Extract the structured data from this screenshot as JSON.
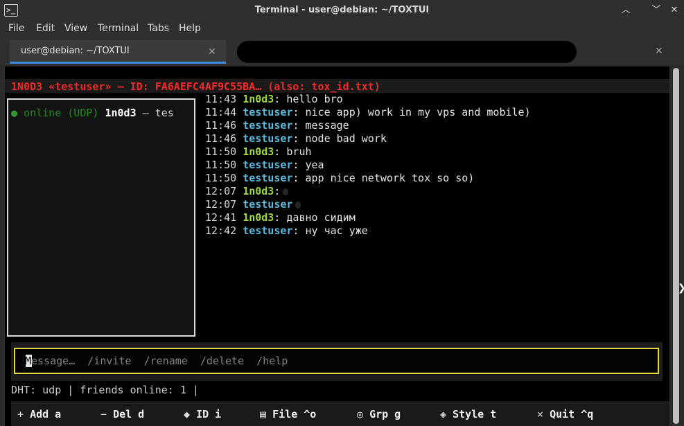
{
  "window": {
    "title": "Terminal - user@debian: ~/TOXTUI",
    "app_icon": ">_",
    "buttons": {
      "up": "︿",
      "down": "﹀",
      "close": "✕"
    }
  },
  "menu": [
    "File",
    "Edit",
    "View",
    "Terminal",
    "Tabs",
    "Help"
  ],
  "tabs": {
    "active_label": "user@debian: ~/TOXTUI",
    "close": "✕"
  },
  "terminal": {
    "header": "1N0D3 «testuser» — ID: FA6AEFC4AF9C55BA… (also: tox_id.txt)",
    "contact": {
      "dot": "●",
      "status": "online (UDP)",
      "name": "1n0d3",
      "rest": " — tes"
    },
    "messages": [
      {
        "time": "11:43",
        "nick": "1n0d3",
        "text": ": hello bro"
      },
      {
        "time": "11:44",
        "nick": "testuser",
        "text": ": nice app) work in my vps and mobile)"
      },
      {
        "time": "11:46",
        "nick": "testuser",
        "text": ": message"
      },
      {
        "time": "11:46",
        "nick": "testuser",
        "text": ": node bad work"
      },
      {
        "time": "11:50",
        "nick": "1n0d3",
        "text": ": bruh"
      },
      {
        "time": "11:50",
        "nick": "testuser",
        "text": ": yea"
      },
      {
        "time": "11:50",
        "nick": "testuser",
        "text": ": app nice network tox so so)"
      },
      {
        "time": "12:07",
        "nick": "1n0d3",
        "text": ":"
      },
      {
        "time": "12:07",
        "nick": "testuser",
        "text": ""
      },
      {
        "time": "12:41",
        "nick": "1n0d3",
        "text": ": давно сидим"
      },
      {
        "time": "12:42",
        "nick": "testuser",
        "text": ": ну час уже"
      }
    ],
    "input": {
      "cursor_char": "M",
      "placeholder": "essage…  /invite  /rename  /delete  /help"
    },
    "status_line": "DHT: udp | friends online: 1 |",
    "footer": [
      {
        "icon": "+",
        "label": "Add a"
      },
      {
        "icon": "−",
        "label": "Del d"
      },
      {
        "icon": "◆",
        "label": "ID i"
      },
      {
        "icon": "▤",
        "label": "File ^o"
      },
      {
        "icon": "◎",
        "label": "Grp g"
      },
      {
        "icon": "◈",
        "label": "Style t"
      },
      {
        "icon": "×",
        "label": "Quit ^q"
      }
    ]
  },
  "colors": {
    "header_red": "#ef2b2b",
    "self_nick": "#9fd642",
    "peer_nick": "#5fb9dd",
    "input_border": "#e3d83a",
    "online_green": "#1f8a1f",
    "tab_accent": "#3d8ee0"
  }
}
